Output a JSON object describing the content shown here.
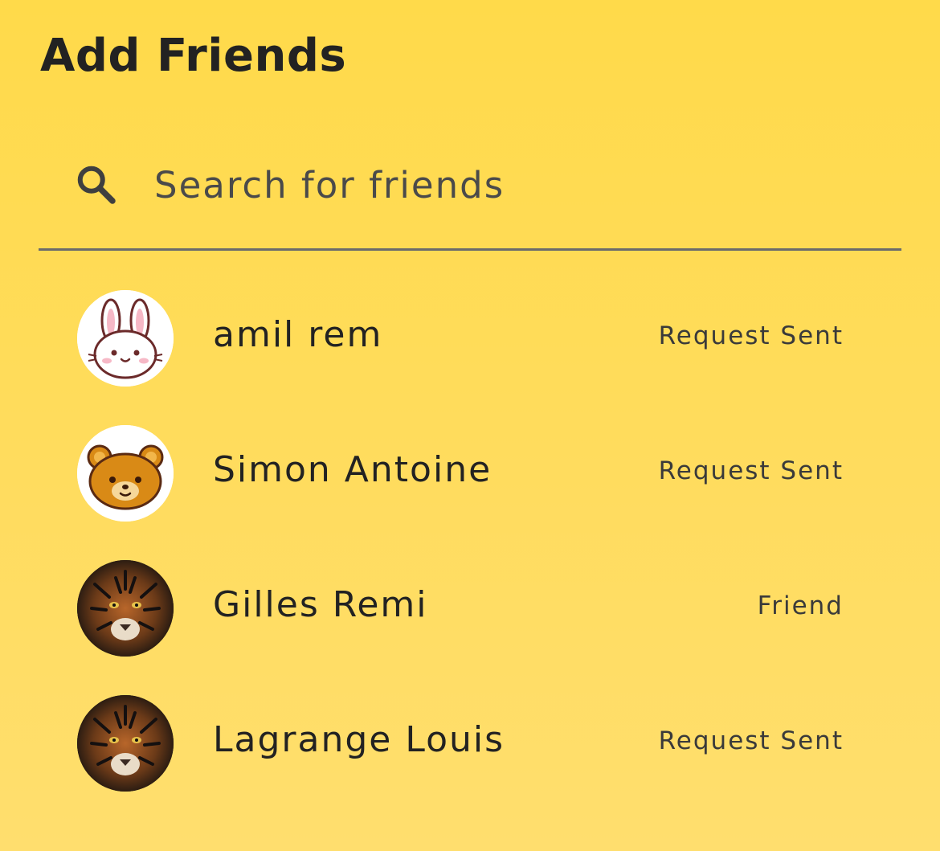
{
  "header": {
    "title": "Add Friends"
  },
  "search": {
    "placeholder": "Search for friends",
    "value": ""
  },
  "friends": [
    {
      "name": "amil rem",
      "status": "Request Sent",
      "avatar": "bunny-icon"
    },
    {
      "name": "Simon Antoine",
      "status": "Request Sent",
      "avatar": "bear-icon"
    },
    {
      "name": "Gilles Remi",
      "status": "Friend",
      "avatar": "tiger-photo"
    },
    {
      "name": "Lagrange Louis",
      "status": "Request Sent",
      "avatar": "tiger-photo"
    }
  ],
  "colors": {
    "background_top": "#FFDA4A",
    "background_bottom": "#FFDE6E",
    "text": "#222222",
    "divider": "#6B6B6B"
  }
}
